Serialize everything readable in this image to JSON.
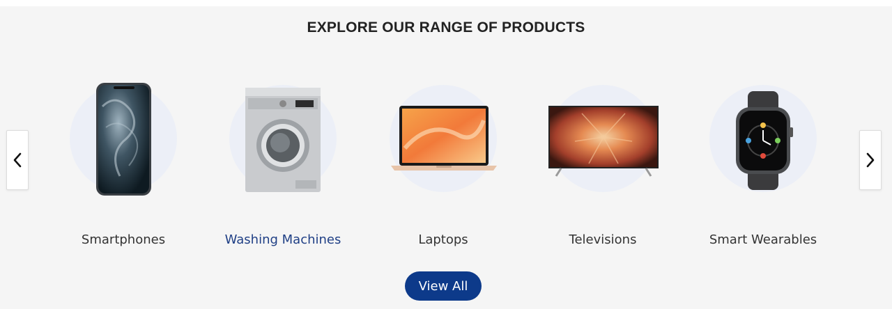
{
  "section": {
    "title": "EXPLORE OUR RANGE OF PRODUCTS",
    "view_all_label": "View All"
  },
  "carousel": {
    "prev_icon": "chevron-left-icon",
    "next_icon": "chevron-right-icon",
    "items": [
      {
        "label": "Smartphones",
        "icon": "smartphone-image",
        "active": false
      },
      {
        "label": "Washing Machines",
        "icon": "washing-machine-image",
        "active": true
      },
      {
        "label": "Laptops",
        "icon": "laptop-image",
        "active": false
      },
      {
        "label": "Televisions",
        "icon": "television-image",
        "active": false
      },
      {
        "label": "Smart Wearables",
        "icon": "smartwatch-image",
        "active": false
      }
    ]
  },
  "colors": {
    "background": "#f5f5f5",
    "accent": "#0d3a8a",
    "active_label": "#1f3f85",
    "circle": "#eceff7"
  }
}
